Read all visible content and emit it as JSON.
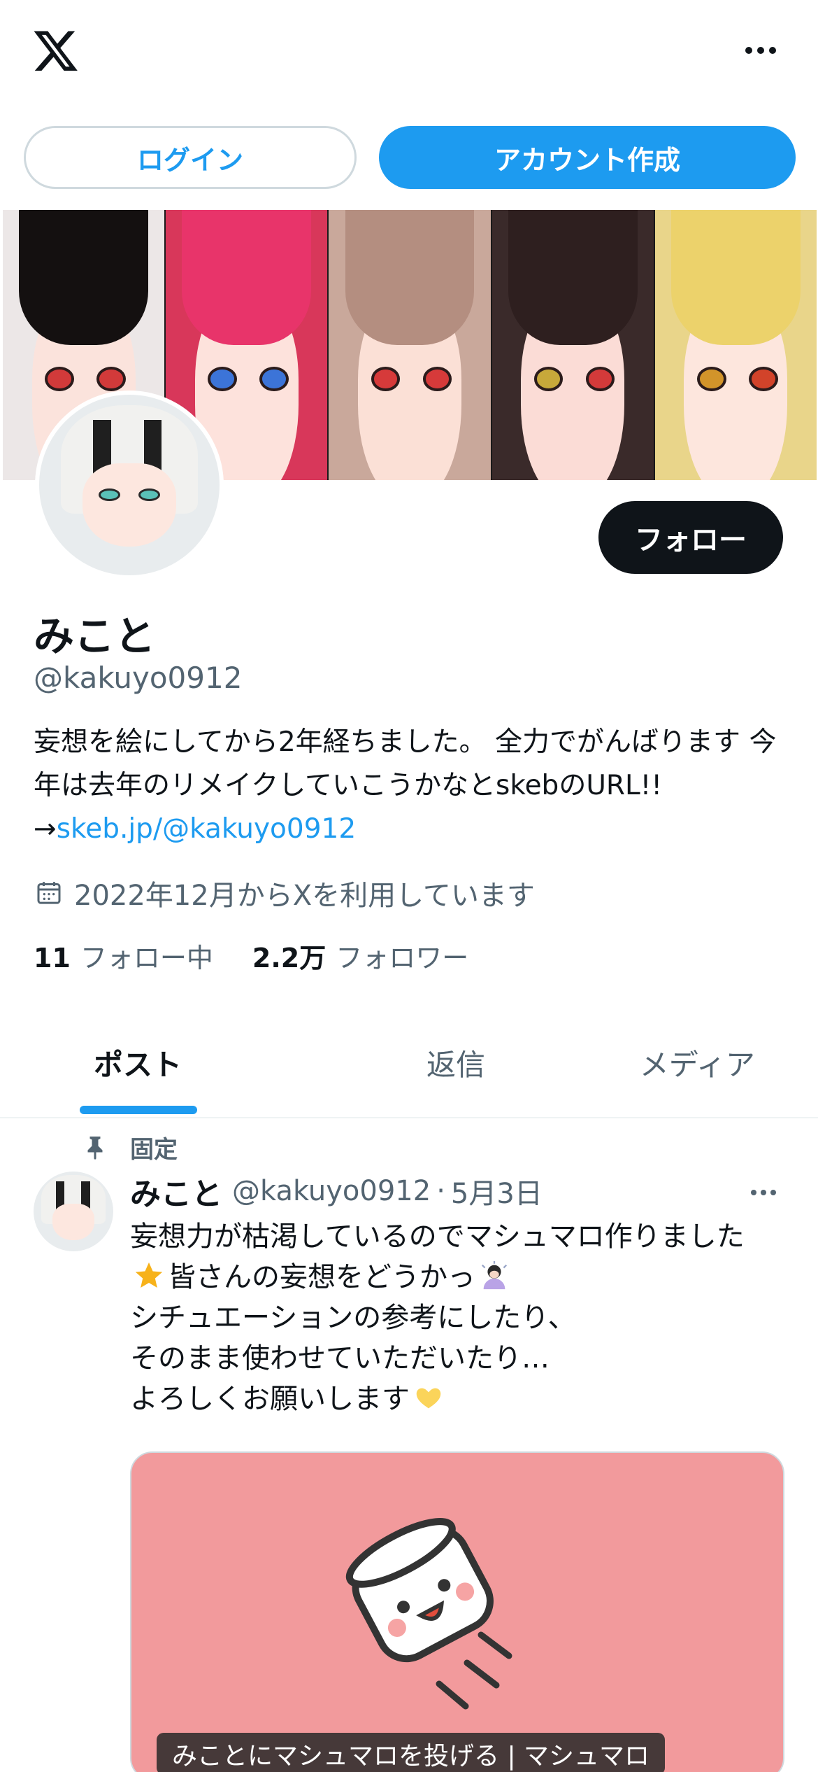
{
  "header": {
    "logo_icon": "x-logo-icon",
    "more_icon": "more-horizontal-icon"
  },
  "auth": {
    "login_label": "ログイン",
    "signup_label": "アカウント作成"
  },
  "profile": {
    "display_name": "みこと",
    "handle": "@kakuyo0912",
    "follow_label": "フォロー",
    "bio_text": "妄想を絵にしてから2年経ちました。 全力でがんばります 今年は去年のリメイクしていこうかなとskebのURL!!",
    "bio_arrow": "→",
    "bio_link": "skeb.jp/@kakuyo0912",
    "joined": "2022年12月からXを利用しています",
    "following_count": "11",
    "following_label": "フォロー中",
    "followers_count": "2.2万",
    "followers_label": "フォロワー"
  },
  "tabs": [
    {
      "label": "ポスト",
      "active": true
    },
    {
      "label": "返信",
      "active": false
    },
    {
      "label": "メディア",
      "active": false
    }
  ],
  "post": {
    "pinned_label": "固定",
    "author_name": "みこと",
    "author_handle": "@kakuyo0912",
    "separator": "·",
    "date": "5月3日",
    "lines": [
      "妄想力が枯渇しているのでマシュマロ作りました",
      "皆さんの妄想をどうかっ",
      "シチュエーションの参考にしたり、",
      "そのまま使わせていただいたり…",
      "よろしくお願いします"
    ],
    "card_caption": "みことにマシュマロを投げる | マシュマロ"
  },
  "colors": {
    "accent": "#1d9bf0",
    "text_primary": "#0f1419",
    "text_secondary": "#536471",
    "card_bg": "#f29a9c"
  }
}
